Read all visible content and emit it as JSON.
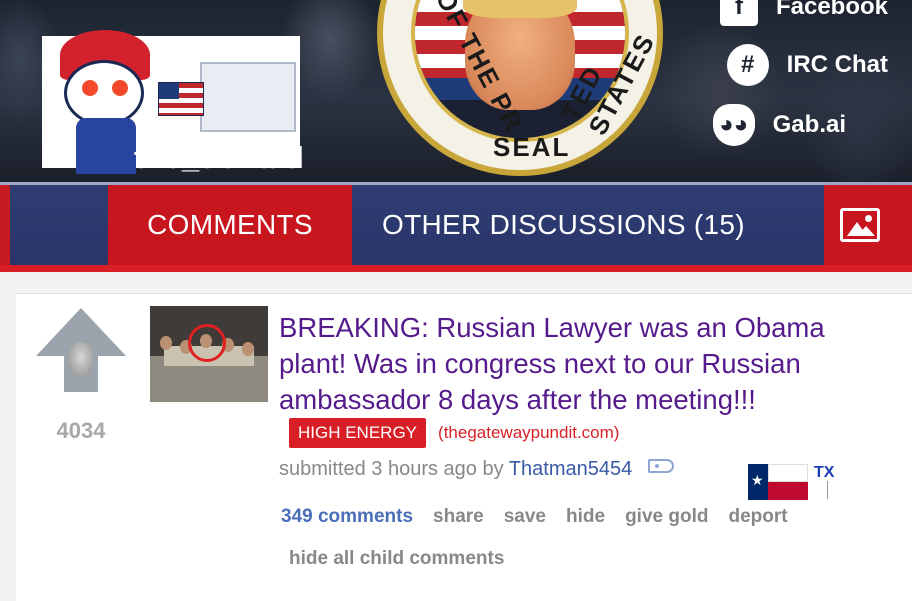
{
  "banner": {
    "subreddit_name": "the_donald",
    "seal_text_left": "OF THE PR",
    "seal_text_right": "TED STATES",
    "seal_text_bottom": "SEAL",
    "social_links": [
      {
        "label": "Facebook",
        "icon": "facebook-icon"
      },
      {
        "label": "IRC Chat",
        "icon": "hashtag-icon"
      },
      {
        "label": "Gab.ai",
        "icon": "frog-icon"
      }
    ]
  },
  "tabs": {
    "comments": "COMMENTS",
    "other_discussions": "OTHER DISCUSSIONS (15)",
    "image_icon": "image-icon"
  },
  "post": {
    "score": "4034",
    "title": "BREAKING: Russian Lawyer was an Obama plant! Was in congress next to our Russian ambassador 8 days after the meeting!!!",
    "flair": "HIGH ENERGY",
    "domain": "(thegatewaypundit.com)",
    "submitted_prefix": "submitted 3 hours ago by",
    "author": "Thatman5454",
    "user_flair_label": "TX",
    "buttons": {
      "comments": "349 comments",
      "share": "share",
      "save": "save",
      "hide": "hide",
      "give_gold": "give gold",
      "deport": "deport"
    },
    "hide_all": "hide all child comments"
  },
  "colors": {
    "accent_red": "#d81f26",
    "nav_blue": "#2f3d72",
    "title_purple": "#551a8b",
    "author_blue": "#3a5aa8"
  }
}
